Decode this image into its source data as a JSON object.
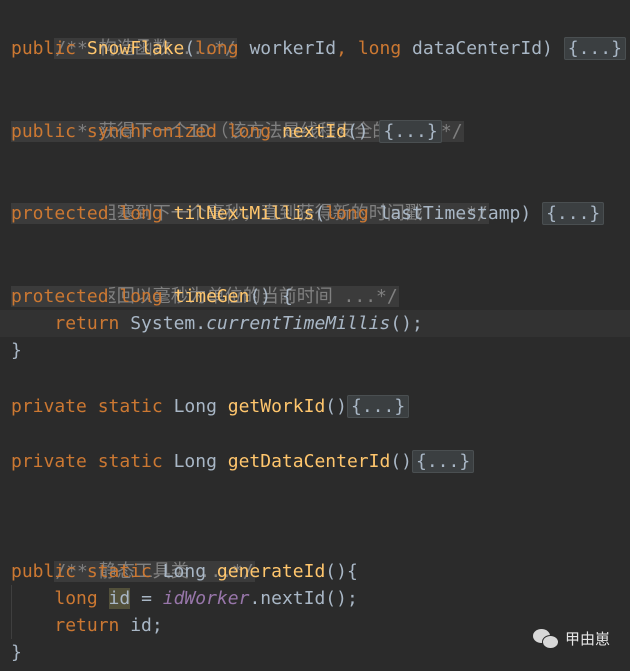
{
  "code": {
    "c1": "/** 构造函数 ...*/",
    "l2_kw": "public ",
    "l2_fn": "SnowFlake",
    "l2_p1": "(",
    "l2_t1": "long ",
    "l2_a1": "workerId",
    "l2_sep": ", ",
    "l2_t2": "long ",
    "l2_a2": "dataCenterId) ",
    "fold": "{...}",
    "c2": "/** 获得下一个ID（该方法是线程安全的）...*/",
    "l5_kw1": "public",
    "l5_kw2": " synchronized long ",
    "l5_fn": "nextId",
    "l5_rest": "() ",
    "c3": "/** 阻塞到下一个毫秒，直到获得新的时间戳 ...*/",
    "l8_kw1": "protected",
    "l8_kw2": " long ",
    "l8_fn": "tilNextMillis",
    "l8_p": "(",
    "l8_t": "long ",
    "l8_a": "lastTimestamp) ",
    "c4": "/** 返回以毫秒为单位的当前时间 ...*/",
    "l11_kw1": "protected",
    "l11_kw2": " long ",
    "l11_fn": "timeGen",
    "l11_rest": "() {",
    "l12_kw": "return ",
    "l12_obj": "System.",
    "l12_call": "currentTimeMillis",
    "l12_end": "();",
    "close": "}",
    "l15_kw": "private static ",
    "l15_type": "Long ",
    "l15_fn": "getWorkId",
    "l15_p": "()",
    "l17_fn": "getDataCenterId",
    "c5": "/** 静态工具类 ...*/",
    "l21_kw": "public static ",
    "l21_type": "Long ",
    "l21_fn": "generateId",
    "l21_rest": "(){",
    "l22_t": "long ",
    "l22_var": "id",
    "l22_eq": " = ",
    "l22_field": "idWorker",
    "l22_call": ".nextId();",
    "l23_kw": "return ",
    "l23_rest": "id;"
  },
  "watermark": {
    "icon": "wechat-icon",
    "label": "甲由崽"
  },
  "colors": {
    "background": "#2b2b2b",
    "keyword": "#cc7832",
    "method": "#ffc66d",
    "comment": "#808080",
    "field": "#9876aa",
    "text": "#a9b7c6"
  }
}
